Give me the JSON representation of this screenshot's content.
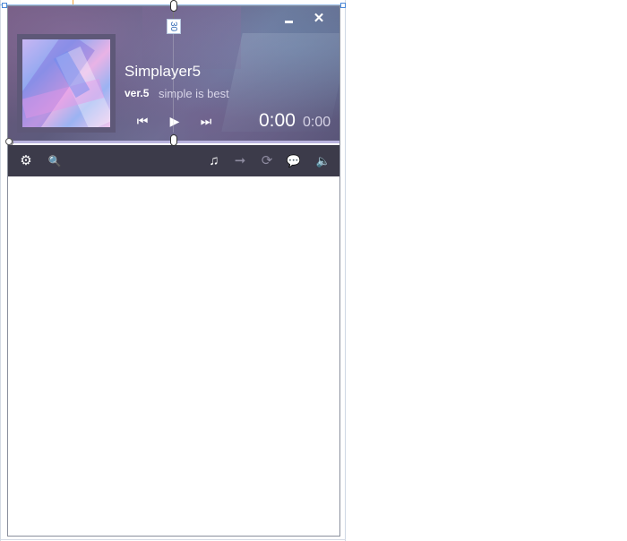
{
  "app": {
    "title": "Simplayer5",
    "version": "ver.5",
    "tagline": "simple is best"
  },
  "window_controls": {
    "minimize_icon": "minimize-icon",
    "close_glyph": "✕"
  },
  "transport": {
    "previous_glyph": "⏮",
    "play_glyph": "▶",
    "next_glyph": "⏭"
  },
  "time": {
    "elapsed": "0:00",
    "total": "0:00"
  },
  "toolbar": {
    "settings_glyph": "⚙",
    "search_glyph": "🔍",
    "music_glyph": "♫",
    "next_track_glyph": "➞",
    "repeat_glyph": "⟳",
    "lyrics_glyph": "💬",
    "volume_glyph": "🔈"
  },
  "designer": {
    "margin_value": "30"
  },
  "colors": {
    "toolbar_bg": "#3c3b4a",
    "progress": "#b9b3df",
    "playlist_bg": "#ffffff"
  }
}
